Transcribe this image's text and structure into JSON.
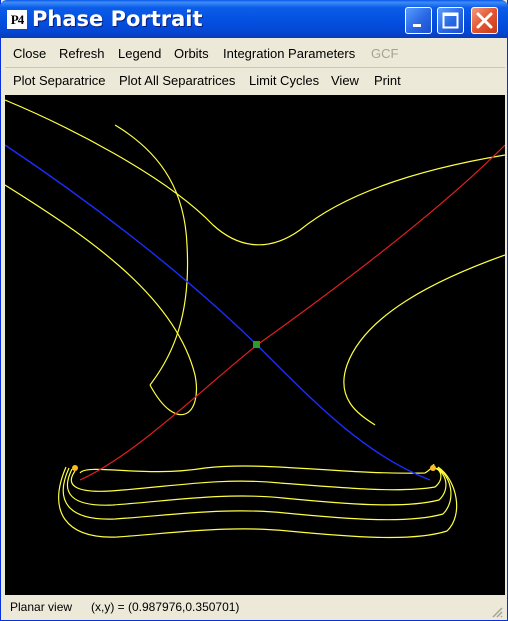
{
  "window": {
    "title": "Phase Portrait",
    "icon_text": "P4"
  },
  "menu_row1": [
    {
      "label": "Close",
      "enabled": true
    },
    {
      "label": "Refresh",
      "enabled": true
    },
    {
      "label": "Legend",
      "enabled": true
    },
    {
      "label": "Orbits",
      "enabled": true
    },
    {
      "label": "Integration Parameters",
      "enabled": true
    },
    {
      "label": "GCF",
      "enabled": false
    }
  ],
  "menu_row2": [
    {
      "label": "Plot Separatrice"
    },
    {
      "label": "Plot All Separatrices"
    },
    {
      "label": "Limit Cycles"
    },
    {
      "label": "View"
    },
    {
      "label": "Print"
    }
  ],
  "status": {
    "view": "Planar view",
    "coords": "(x,y) = (0.987976,0.350701)"
  },
  "colors": {
    "background": "#000000",
    "orbit": "#ffff44",
    "stable_separatrix": "#1a2dff",
    "unstable_separatrix": "#e02020",
    "saddle": "#2a9a2a"
  },
  "icons": [
    "minimize-icon",
    "maximize-icon",
    "close-icon",
    "resize-grip-icon"
  ]
}
